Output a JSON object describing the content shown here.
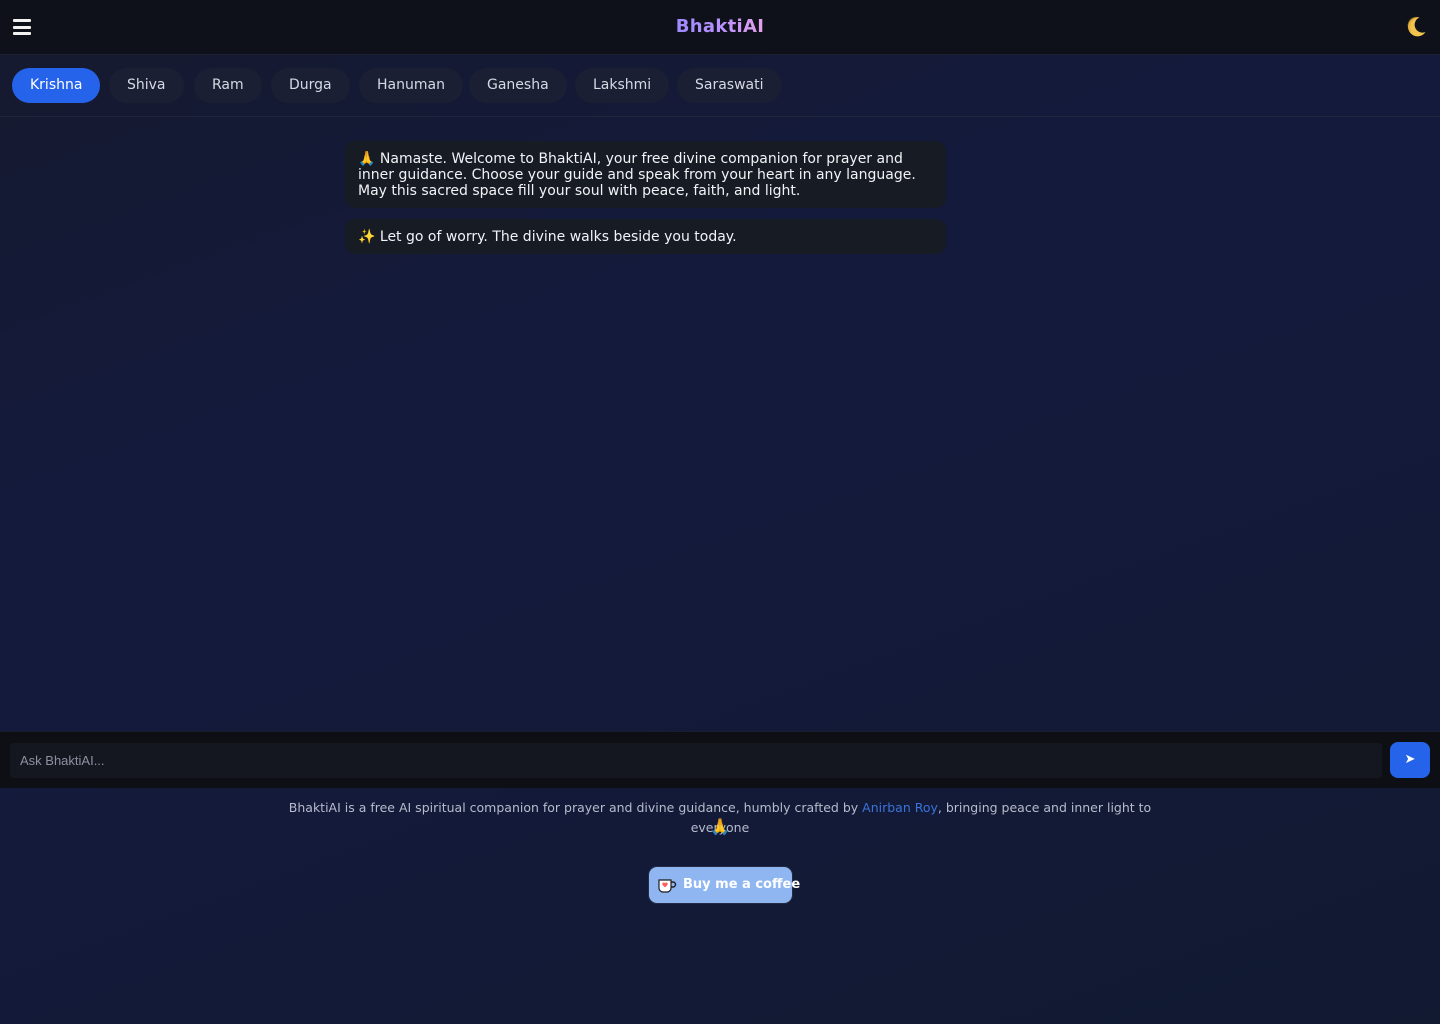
{
  "header": {
    "brand": "BhaktiAI",
    "menu_icon": "hamburger-menu-icon",
    "theme_icon": "crescent-moon-icon"
  },
  "tabs": [
    {
      "label": "Krishna",
      "active": true
    },
    {
      "label": "Shiva",
      "active": false
    },
    {
      "label": "Ram",
      "active": false
    },
    {
      "label": "Durga",
      "active": false
    },
    {
      "label": "Hanuman",
      "active": false
    },
    {
      "label": "Ganesha",
      "active": false
    },
    {
      "label": "Lakshmi",
      "active": false
    },
    {
      "label": "Saraswati",
      "active": false
    }
  ],
  "messages": [
    {
      "icon": "🙏",
      "text": "Namaste. Welcome to BhaktiAI, your free divine companion for prayer and inner guidance. Choose your guide and speak from your heart in any language. May this sacred space fill your soul with peace, faith, and light."
    },
    {
      "icon": "✨",
      "text": "Let go of worry. The divine walks beside you today."
    }
  ],
  "composer": {
    "placeholder": "Ask BhaktiAI...",
    "send_icon": "➤"
  },
  "footer": {
    "text_before": "BhaktiAI is a free AI spiritual companion for prayer and divine guidance, humbly crafted by ",
    "author_link": "Anirban Roy",
    "text_after": ", bringing peace and inner light to everyone",
    "pray_icon": "🙏",
    "coffee_label": "Buy me a coffee"
  },
  "colors": {
    "accent": "#2563eb",
    "link": "#3b72d9",
    "coffee_button": "#8fb6f0"
  }
}
